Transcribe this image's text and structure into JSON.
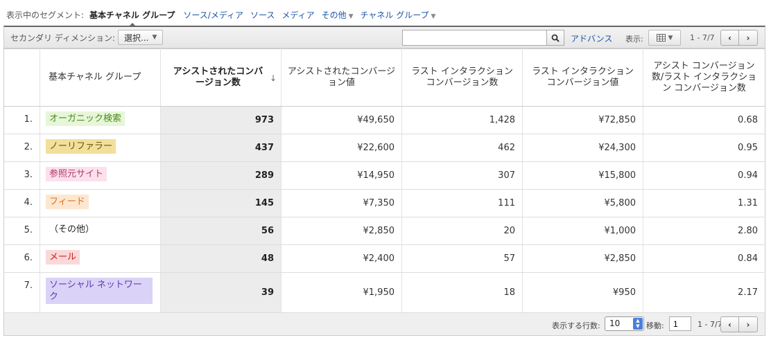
{
  "segments": {
    "label": "表示中のセグメント:",
    "active": "基本チャネル グループ",
    "links": [
      {
        "label": "ソース/メディア"
      },
      {
        "label": "ソース"
      },
      {
        "label": "メディア"
      },
      {
        "label": "その他"
      },
      {
        "label": "チャネル グループ"
      }
    ]
  },
  "toolbar": {
    "secondary_label": "セカンダリ ディメンション:",
    "select_label": "選択...",
    "search_value": "",
    "advanced_label": "アドバンス",
    "display_label": "表示:",
    "range": "1 - 7/7"
  },
  "table": {
    "headers": {
      "dimension": "基本チャネル グループ",
      "assisted_conversions": "アシストされたコンバージョン数",
      "assisted_value": "アシストされたコンバージョン値",
      "last_click_conversions": "ラスト インタラクション コンバージョン数",
      "last_click_value": "ラスト インタラクション コンバージョン値",
      "ratio": "アシスト コンバージョン数/ラスト インタラクション コンバージョン数"
    },
    "rows": [
      {
        "index": "1.",
        "channel": "オーガニック検索",
        "assisted": "973",
        "assisted_value": "¥49,650",
        "last": "1,428",
        "last_value": "¥72,850",
        "ratio": "0.68"
      },
      {
        "index": "2.",
        "channel": "ノーリファラー",
        "assisted": "437",
        "assisted_value": "¥22,600",
        "last": "462",
        "last_value": "¥24,300",
        "ratio": "0.95"
      },
      {
        "index": "3.",
        "channel": "参照元サイト",
        "assisted": "289",
        "assisted_value": "¥14,950",
        "last": "307",
        "last_value": "¥15,800",
        "ratio": "0.94"
      },
      {
        "index": "4.",
        "channel": "フィード",
        "assisted": "145",
        "assisted_value": "¥7,350",
        "last": "111",
        "last_value": "¥5,800",
        "ratio": "1.31"
      },
      {
        "index": "5.",
        "channel": "（その他）",
        "assisted": "56",
        "assisted_value": "¥2,850",
        "last": "20",
        "last_value": "¥1,000",
        "ratio": "2.80"
      },
      {
        "index": "6.",
        "channel": "メール",
        "assisted": "48",
        "assisted_value": "¥2,400",
        "last": "57",
        "last_value": "¥2,850",
        "ratio": "0.84"
      },
      {
        "index": "7.",
        "channel": "ソーシャル ネットワーク",
        "assisted": "39",
        "assisted_value": "¥1,950",
        "last": "18",
        "last_value": "¥950",
        "ratio": "2.17"
      }
    ]
  },
  "chip_colors": {
    "organic": {
      "bg": "#e7f6d9",
      "fg": "#4a8a18"
    },
    "direct": {
      "bg": "#f1df9b",
      "fg": "#6b5600"
    },
    "referral": {
      "bg": "#fbe1ec",
      "fg": "#b43a6d"
    },
    "feed": {
      "bg": "#fde7d0",
      "fg": "#e0701d"
    },
    "email": {
      "bg": "#fbd9d9",
      "fg": "#cc1c1c"
    },
    "social": {
      "bg": "#dbd2f7",
      "fg": "#5a3cb0"
    }
  },
  "footer": {
    "rows_label": "表示する行数:",
    "rows_value": "10",
    "goto_label": "移動:",
    "goto_value": "1",
    "range": "1 - 7/7"
  }
}
